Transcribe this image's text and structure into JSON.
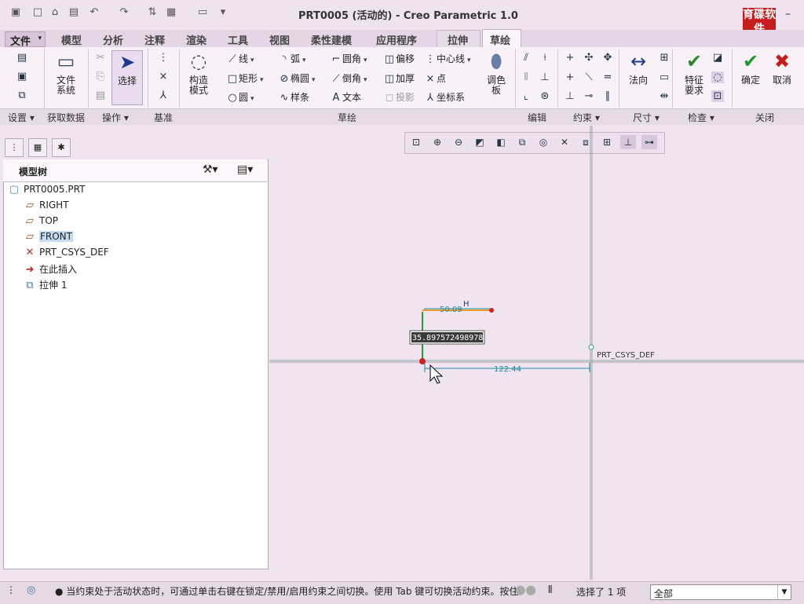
{
  "window": {
    "title": "PRT0005 (活动的) - Creo Parametric 1.0",
    "logo_text": "育碟软件"
  },
  "menu": {
    "file": "文件",
    "tabs": [
      "模型",
      "分析",
      "注释",
      "渲染",
      "工具",
      "视图",
      "柔性建模",
      "应用程序",
      "拉伸",
      "草绘"
    ],
    "active_tab": "草绘"
  },
  "ribbon": {
    "setup": {
      "file_system": "文件系统"
    },
    "operations": {
      "select": "选择"
    },
    "datum": {},
    "construct": "构造模式",
    "sketch": {
      "line": "线",
      "arc": "弧",
      "fillet": "圆角",
      "offset": "偏移",
      "centerline": "中心线",
      "rectangle": "矩形",
      "ellipse": "椭圆",
      "chamfer": "倒角",
      "thicken": "加厚",
      "point": "点",
      "circle": "圆",
      "spline": "样条",
      "text": "文本",
      "project": "投影",
      "coord_sys": "坐标系",
      "palette": "调色板"
    },
    "dimension": {
      "normal": "法向"
    },
    "inspect": {
      "feature_req": "特征要求"
    },
    "close": {
      "ok": "确定",
      "cancel": "取消"
    },
    "groups": [
      "设置",
      "获取数据",
      "操作",
      "基准",
      "草绘",
      "编辑",
      "约束",
      "尺寸",
      "检查",
      "关闭"
    ]
  },
  "model_tree": {
    "title": "模型树",
    "items": [
      {
        "label": "PRT0005.PRT",
        "icon": "part-icon"
      },
      {
        "label": "RIGHT",
        "icon": "datum-plane-icon"
      },
      {
        "label": "TOP",
        "icon": "datum-plane-icon"
      },
      {
        "label": "FRONT",
        "icon": "datum-plane-icon"
      },
      {
        "label": "PRT_CSYS_DEF",
        "icon": "csys-icon"
      },
      {
        "label": "在此插入",
        "icon": "insert-arrow-icon"
      },
      {
        "label": "拉伸 1",
        "icon": "extrude-icon"
      }
    ],
    "selected": "FRONT"
  },
  "canvas": {
    "csys_label": "PRT_CSYS_DEF",
    "dim_top": "50.09",
    "constraint_h": "H",
    "dim_bottom": "122.44",
    "input_value": "35.897572498978"
  },
  "status": {
    "message": "● 当约束处于活动状态时，可通过单击右键在锁定/禁用/启用约束之间切换。使用 Tab 键可切换活动约束。按住",
    "selected_count": "选择了 1 项",
    "filter": "全部"
  },
  "colors": {
    "background": "#f1e4f1",
    "axis_line": "#3aa0a0",
    "dim_color": "#1d8ca0",
    "point_red": "#cc2222",
    "sketch_green": "#33aa33"
  }
}
